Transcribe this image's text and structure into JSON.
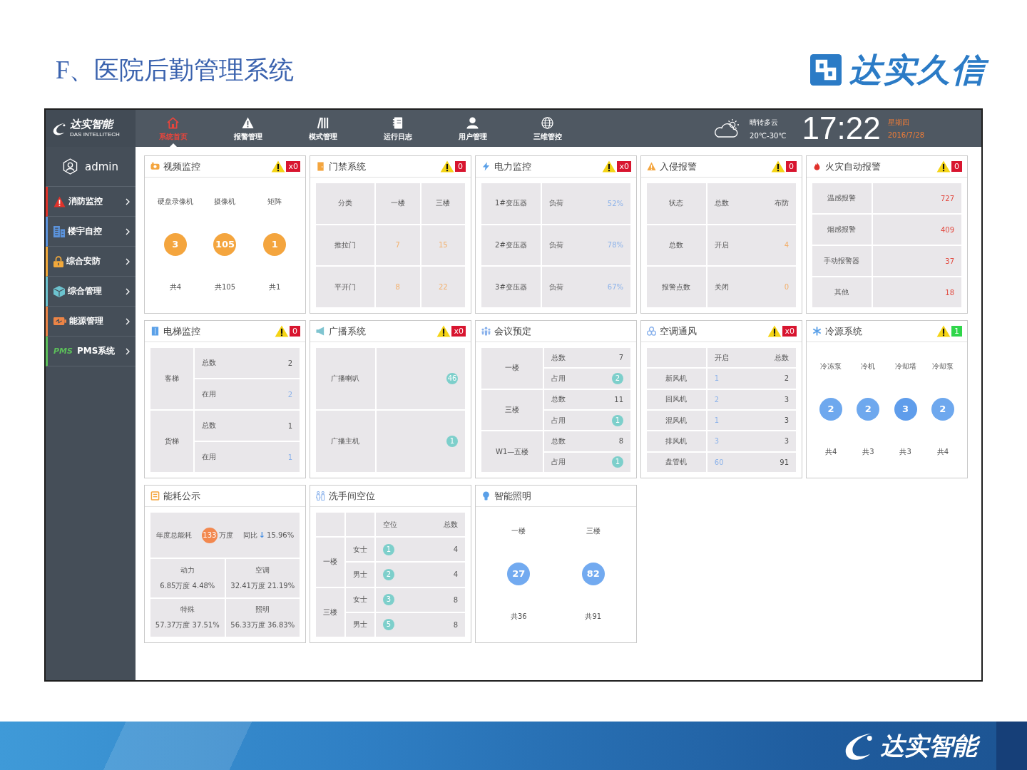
{
  "slide": {
    "title": "F、医院后勤管理系统",
    "brand": "达实久信"
  },
  "topbar": {
    "logo": "达实智能",
    "logo_subtitle": "DAS INTELLITECH",
    "nav": [
      {
        "label": "系统首页",
        "selected": true
      },
      {
        "label": "报警管理",
        "selected": false
      },
      {
        "label": "模式管理",
        "selected": false
      },
      {
        "label": "运行日志",
        "selected": false
      },
      {
        "label": "用户管理",
        "selected": false
      },
      {
        "label": "三维管控",
        "selected": false
      }
    ],
    "weather": {
      "condition": "晴转多云",
      "temperature": "20℃-30℃"
    },
    "time": "17:22",
    "weekday": "星期四",
    "date": "2016/7/28"
  },
  "sidebar": {
    "user": "admin",
    "items": [
      {
        "label": "消防监控",
        "color": "#e0322a"
      },
      {
        "label": "楼宇自控",
        "color": "#5b93dc"
      },
      {
        "label": "综合安防",
        "color": "#f2a93b"
      },
      {
        "label": "综合管理",
        "color": "#6cc3cf"
      },
      {
        "label": "能源管理",
        "color": "#ec8446"
      },
      {
        "label": "PMS系统",
        "logo": "PMS",
        "color": "#5cc05a"
      }
    ]
  },
  "panels": [
    {
      "title": "视频监控",
      "alert": {
        "count": "x0",
        "color": "#d8152f"
      },
      "kind": "counters",
      "items": [
        {
          "label": "硬盘录像机",
          "value": "3",
          "total": "共4",
          "color": "#f4a53e"
        },
        {
          "label": "摄像机",
          "value": "105",
          "total": "共105",
          "color": "#f4a53e"
        },
        {
          "label": "矩阵",
          "value": "1",
          "total": "共1",
          "color": "#f4a53e"
        }
      ]
    },
    {
      "title": "门禁系统",
      "alert": {
        "count": "0",
        "color": "#d8152f"
      },
      "kind": "matrix",
      "rows": [
        [
          {
            "text": "分类"
          },
          {
            "text": "一楼"
          },
          {
            "text": "三楼"
          }
        ],
        [
          {
            "text": "推拉门"
          },
          {
            "text": "7",
            "color": "#f3b06c"
          },
          {
            "text": "15",
            "color": "#f3b06c"
          }
        ],
        [
          {
            "text": "平开门"
          },
          {
            "text": "8",
            "color": "#f3b06c"
          },
          {
            "text": "22",
            "color": "#f3b06c"
          }
        ]
      ]
    },
    {
      "title": "电力监控",
      "alert": {
        "count": "x0",
        "color": "#d8152f"
      },
      "kind": "table",
      "rows": [
        [
          {
            "text": "1#变压器"
          },
          {
            "parts": [
              {
                "text": "负荷"
              },
              {
                "text": "52%",
                "color": "#8db3ea"
              }
            ]
          }
        ],
        [
          {
            "text": "2#变压器"
          },
          {
            "parts": [
              {
                "text": "负荷"
              },
              {
                "text": "78%",
                "color": "#8db3ea"
              }
            ]
          }
        ],
        [
          {
            "text": "3#变压器"
          },
          {
            "parts": [
              {
                "text": "负荷"
              },
              {
                "text": "67%",
                "color": "#8db3ea"
              }
            ]
          }
        ]
      ]
    },
    {
      "title": "入侵报警",
      "alert": {
        "count": "0",
        "color": "#d8152f"
      },
      "kind": "table",
      "rows": [
        [
          {
            "text": "状态"
          },
          {
            "parts": [
              {
                "text": "总数"
              },
              {
                "text": "布防"
              }
            ]
          }
        ],
        [
          {
            "text": "总数"
          },
          {
            "parts": [
              {
                "text": "开启"
              },
              {
                "text": "4",
                "color": "#f3b06c"
              }
            ]
          }
        ],
        [
          {
            "text": "报警点数"
          },
          {
            "parts": [
              {
                "text": "关闭"
              },
              {
                "text": "0",
                "color": "#f3b06c"
              }
            ]
          }
        ]
      ]
    },
    {
      "title": "火灾自动报警",
      "alert": {
        "count": "0",
        "color": "#d8152f"
      },
      "kind": "table",
      "rows": [
        [
          {
            "text": "温感报警"
          },
          {
            "text": "727",
            "color": "#e2493f"
          }
        ],
        [
          {
            "text": "烟感报警"
          },
          {
            "text": "409",
            "color": "#e2493f"
          }
        ],
        [
          {
            "text": "手动报警器"
          },
          {
            "text": "37",
            "color": "#e2493f"
          }
        ],
        [
          {
            "text": "其他"
          },
          {
            "text": "18",
            "color": "#e2493f"
          }
        ]
      ]
    },
    {
      "title": "电梯监控",
      "alert": {
        "count": "0",
        "color": "#d8152f"
      },
      "kind": "grouped",
      "groups": [
        {
          "label": "客梯",
          "rows": [
            [
              {
                "parts": [
                  {
                    "text": "总数"
                  },
                  {
                    "text": "2"
                  }
                ]
              }
            ],
            [
              {
                "parts": [
                  {
                    "text": "在用"
                  },
                  {
                    "text": "2",
                    "color": "#8db3ea"
                  }
                ]
              }
            ]
          ]
        },
        {
          "label": "货梯",
          "rows": [
            [
              {
                "parts": [
                  {
                    "text": "总数"
                  },
                  {
                    "text": "1"
                  }
                ]
              }
            ],
            [
              {
                "parts": [
                  {
                    "text": "在用"
                  },
                  {
                    "text": "1",
                    "color": "#8db3ea"
                  }
                ]
              }
            ]
          ]
        }
      ]
    },
    {
      "title": "广播系统",
      "alert": {
        "count": "x0",
        "color": "#d8152f"
      },
      "kind": "table",
      "rows": [
        [
          {
            "kind": "text",
            "text": "广播喇叭"
          },
          {
            "kind": "dot",
            "text": "46",
            "color": "#7dcfcb"
          }
        ],
        [
          {
            "kind": "text",
            "text": "广播主机"
          },
          {
            "kind": "dot",
            "text": "1",
            "color": "#7dcfcb"
          }
        ]
      ]
    },
    {
      "title": "会议预定",
      "kind": "grouped",
      "groups": [
        {
          "label": "一楼",
          "rows": [
            [
              {
                "parts": [
                  {
                    "kind": "text",
                    "text": "总数"
                  },
                  {
                    "kind": "text",
                    "text": "7"
                  }
                ]
              }
            ],
            [
              {
                "parts": [
                  {
                    "kind": "text",
                    "text": "占用"
                  },
                  {
                    "kind": "dot",
                    "text": "2",
                    "color": "#7dcfcb"
                  }
                ]
              }
            ]
          ]
        },
        {
          "label": "三楼",
          "rows": [
            [
              {
                "parts": [
                  {
                    "kind": "text",
                    "text": "总数"
                  },
                  {
                    "kind": "text",
                    "text": "11"
                  }
                ]
              }
            ],
            [
              {
                "parts": [
                  {
                    "kind": "text",
                    "text": "占用"
                  },
                  {
                    "kind": "dot",
                    "text": "1",
                    "color": "#7dcfcb"
                  }
                ]
              }
            ]
          ]
        },
        {
          "label": "W1—五楼",
          "rows": [
            [
              {
                "parts": [
                  {
                    "kind": "text",
                    "text": "总数"
                  },
                  {
                    "kind": "text",
                    "text": "8"
                  }
                ]
              }
            ],
            [
              {
                "parts": [
                  {
                    "kind": "text",
                    "text": "占用"
                  },
                  {
                    "kind": "dot",
                    "text": "1",
                    "color": "#7dcfcb"
                  }
                ]
              }
            ]
          ]
        }
      ]
    },
    {
      "title": "空调通风",
      "alert": {
        "count": "x0",
        "color": "#d8152f"
      },
      "kind": "table",
      "rows": [
        [
          "",
          {
            "parts": [
              {
                "text": "开启"
              },
              {
                "text": "总数"
              }
            ]
          }
        ],
        [
          {
            "text": "新风机"
          },
          {
            "parts": [
              {
                "text": "1",
                "color": "#8db3ea"
              },
              {
                "text": "2"
              }
            ]
          }
        ],
        [
          {
            "text": "回风机"
          },
          {
            "parts": [
              {
                "text": "2",
                "color": "#8db3ea"
              },
              {
                "text": "3"
              }
            ]
          }
        ],
        [
          {
            "text": "混风机"
          },
          {
            "parts": [
              {
                "text": "1",
                "color": "#8db3ea"
              },
              {
                "text": "3"
              }
            ]
          }
        ],
        [
          {
            "text": "排风机"
          },
          {
            "parts": [
              {
                "text": "3",
                "color": "#8db3ea"
              },
              {
                "text": "3"
              }
            ]
          }
        ],
        [
          {
            "text": "盘管机"
          },
          {
            "parts": [
              {
                "text": "60",
                "color": "#8db3ea"
              },
              {
                "text": "91"
              }
            ]
          }
        ]
      ]
    },
    {
      "title": "冷源系统",
      "alert": {
        "count": "1",
        "color": "#2fd64a"
      },
      "kind": "counters",
      "items": [
        {
          "label": "冷冻泵",
          "value": "2",
          "total": "共4",
          "color": "#6ea8ee"
        },
        {
          "label": "冷机",
          "value": "2",
          "total": "共3",
          "color": "#6ea8ee"
        },
        {
          "label": "冷却塔",
          "value": "3",
          "total": "共3",
          "color": "#5f9deb"
        },
        {
          "label": "冷却泵",
          "value": "2",
          "total": "共4",
          "color": "#6ea8ee"
        }
      ]
    },
    {
      "title": "能耗公示",
      "kind": "energy",
      "summary": {
        "label": "年度总能耗",
        "value": "133",
        "unit": "万度",
        "color": "#f2884f",
        "compare": "同比",
        "arrow": "↓",
        "change": "15.96%"
      },
      "items": [
        {
          "name": "动力",
          "amount": "6.85万度 4.48%"
        },
        {
          "name": "空调",
          "amount": "32.41万度 21.19%"
        },
        {
          "name": "特殊",
          "amount": "57.37万度 37.51%"
        },
        {
          "name": "照明",
          "amount": "56.33万度 36.83%"
        }
      ]
    },
    {
      "title": "洗手间空位",
      "kind": "grouped",
      "header": [
        {
          "parts": [
            {
              "text": "空位"
            },
            {
              "text": "总数"
            }
          ]
        }
      ],
      "groups": [
        {
          "label": "一楼",
          "rows": [
            [
              {
                "text": "女士"
              },
              {
                "parts": [
                  {
                    "kind": "dot",
                    "text": "1",
                    "color": "#7dcfcb"
                  },
                  {
                    "kind": "text",
                    "text": "4"
                  }
                ]
              }
            ],
            [
              {
                "text": "男士"
              },
              {
                "parts": [
                  {
                    "kind": "dot",
                    "text": "2",
                    "color": "#7dcfcb"
                  },
                  {
                    "kind": "text",
                    "text": "4"
                  }
                ]
              }
            ]
          ]
        },
        {
          "label": "三楼",
          "rows": [
            [
              {
                "text": "女士"
              },
              {
                "parts": [
                  {
                    "kind": "dot",
                    "text": "3",
                    "color": "#7dcfcb"
                  },
                  {
                    "kind": "text",
                    "text": "8"
                  }
                ]
              }
            ],
            [
              {
                "text": "男士"
              },
              {
                "parts": [
                  {
                    "kind": "dot",
                    "text": "5",
                    "color": "#7dcfcb"
                  },
                  {
                    "kind": "text",
                    "text": "8"
                  }
                ]
              }
            ]
          ]
        }
      ]
    },
    {
      "title": "智能照明",
      "kind": "counters",
      "items": [
        {
          "label": "一楼",
          "value": "27",
          "total": "共36",
          "color": "#72aaf0"
        },
        {
          "label": "三楼",
          "value": "82",
          "total": "共91",
          "color": "#72aaf0"
        }
      ]
    }
  ],
  "footer": {
    "brand": "达实智能"
  }
}
